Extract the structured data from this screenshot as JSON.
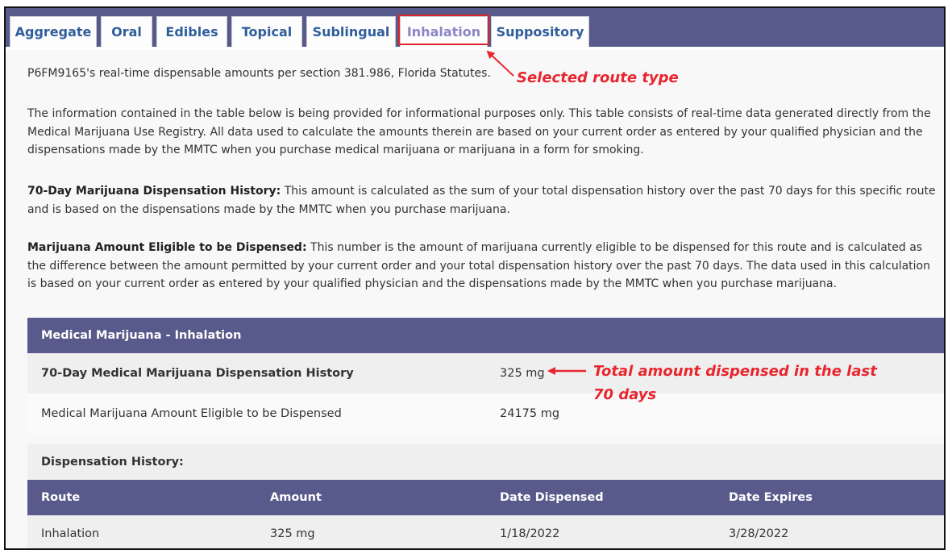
{
  "tabs": [
    {
      "label": "Aggregate",
      "active": false
    },
    {
      "label": "Oral",
      "active": false
    },
    {
      "label": "Edibles",
      "active": false
    },
    {
      "label": "Topical",
      "active": false
    },
    {
      "label": "Sublingual",
      "active": false
    },
    {
      "label": "Inhalation",
      "active": true
    },
    {
      "label": "Suppository",
      "active": false
    }
  ],
  "intro": "P6FM9165's real-time dispensable amounts per section 381.986, Florida Statutes.",
  "disclaimer": "The information contained in the table below is being provided for informational purposes only. This table consists of real-time data generated directly from the Medical Marijuana Use Registry. All data used to calculate the amounts therein are based on your current order as entered by your qualified physician and the dispensations made by the MMTC when you purchase medical marijuana or marijuana in a form for smoking.",
  "history_def": {
    "term": "70-Day Marijuana Dispensation History:",
    "text": " This amount is calculated as the sum of your total dispensation history over the past 70 days for this specific route and is based on the dispensations made by the MMTC when you purchase marijuana."
  },
  "eligible_def": {
    "term": "Marijuana Amount Eligible to be Dispensed:",
    "text": " This number is the amount of marijuana currently eligible to be dispensed for this route and is calculated as the difference between the amount permitted by your current order and your total dispensation history over the past 70 days. The data used in this calculation is based on your current order as entered by your qualified physician and the dispensations made by the MMTC when you purchase marijuana."
  },
  "summary": {
    "header": "Medical Marijuana - Inhalation",
    "history_label": "70-Day Medical Marijuana Dispensation History",
    "history_value": "325 mg",
    "eligible_label": "Medical Marijuana Amount Eligible to be Dispensed",
    "eligible_value": "24175 mg"
  },
  "history_table": {
    "title": "Dispensation History:",
    "columns": [
      "Route",
      "Amount",
      "Date Dispensed",
      "Date Expires"
    ],
    "rows": [
      [
        "Inhalation",
        "325 mg",
        "1/18/2022",
        "3/28/2022"
      ]
    ]
  },
  "annotations": {
    "route_type": "Selected route type",
    "total_line1": "Total amount dispensed in the last",
    "total_line2": "70 days",
    "color": "#e8262e"
  }
}
